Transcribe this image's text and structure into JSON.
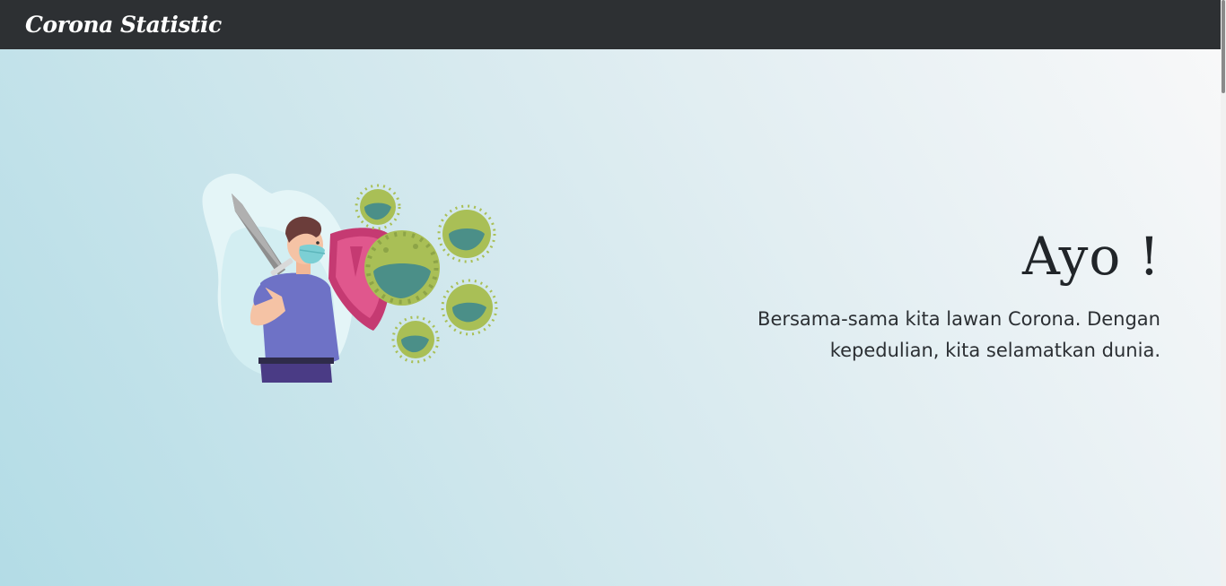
{
  "navbar": {
    "brand": "Corona Statistic"
  },
  "hero": {
    "title": "Ayo !",
    "subtitle": "Bersama-sama kita lawan Corona. Dengan kepedulian, kita selamatkan dunia.",
    "illustration_icon": "person-with-sword-and-shield-fighting-virus-icon"
  },
  "colors": {
    "navbar_bg": "#2d3033",
    "hero_gradient_start": "#b3dce6",
    "hero_gradient_end": "#f8f8f9",
    "text": "#212529"
  }
}
